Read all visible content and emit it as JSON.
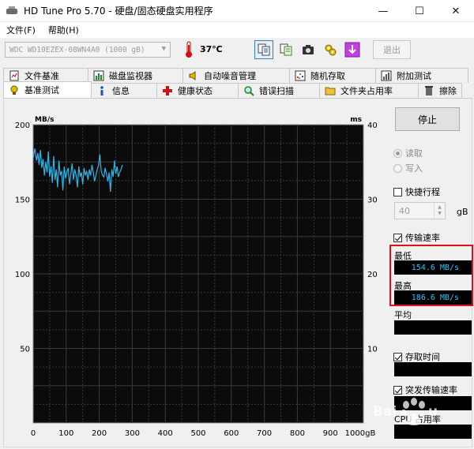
{
  "window": {
    "title": "HD Tune Pro 5.70 - 硬盘/固态硬盘实用程序"
  },
  "window_controls": {
    "minimize": "—",
    "maximize": "☐",
    "close": "✕"
  },
  "menu": [
    {
      "label": "文件(F)"
    },
    {
      "label": "帮助(H)"
    }
  ],
  "toolbar": {
    "drive": "WDC WD10EZEX-08WN4A0 (1000 gB)",
    "temperature": "37℃",
    "exit_label": "退出",
    "icons": [
      "copy-info-icon",
      "copy-table-icon",
      "camera-icon",
      "gear-icon",
      "save-icon"
    ]
  },
  "tabs_top": [
    {
      "label": "文件基准",
      "icon": "file-benchmark-icon"
    },
    {
      "label": "磁盘监视器",
      "icon": "disk-monitor-icon"
    },
    {
      "label": "自动噪音管理",
      "icon": "speaker-icon"
    },
    {
      "label": "随机存取",
      "icon": "random-access-icon"
    },
    {
      "label": "附加测试",
      "icon": "extra-tests-icon"
    }
  ],
  "tabs_bottom": [
    {
      "label": "基准测试",
      "icon": "benchmark-icon"
    },
    {
      "label": "信息",
      "icon": "info-icon"
    },
    {
      "label": "健康状态",
      "icon": "health-icon"
    },
    {
      "label": "错误扫描",
      "icon": "error-scan-icon"
    },
    {
      "label": "文件夹占用率",
      "icon": "folder-icon"
    },
    {
      "label": "擦除",
      "icon": "erase-icon"
    }
  ],
  "side": {
    "stop_label": "停止",
    "read_label": "读取",
    "write_label": "写入",
    "short_stroke_label": "快捷行程",
    "short_stroke_value": "40",
    "short_stroke_unit": "gB",
    "transfer_rate_label": "传输速率",
    "min_label": "最低",
    "min_value": "154.6 MB/s",
    "max_label": "最高",
    "max_value": "186.6 MB/s",
    "avg_label": "平均",
    "access_time_label": "存取时间",
    "burst_rate_label": "突发传输速率",
    "cpu_usage_label": "CPU 占用率"
  },
  "chart_data": {
    "type": "line",
    "ylabel": "MB/s",
    "y2label": "ms",
    "xlabel": "gB",
    "xlim": [
      0,
      1000
    ],
    "ylim": [
      0,
      200
    ],
    "y2lim": [
      0,
      40
    ],
    "xticks": [
      0,
      100,
      200,
      300,
      400,
      500,
      600,
      700,
      800,
      900,
      1000
    ],
    "yticks": [
      50,
      100,
      150,
      200
    ],
    "y2ticks": [
      10,
      20,
      30,
      40
    ],
    "grid": true,
    "series": [
      {
        "color": "#2fb5e8",
        "x": [
          0,
          5,
          10,
          14,
          18,
          22,
          26,
          30,
          34,
          38,
          42,
          46,
          50,
          54,
          58,
          62,
          66,
          70,
          74,
          78,
          82,
          86,
          90,
          94,
          98,
          102,
          106,
          110,
          114,
          118,
          122,
          126,
          130,
          134,
          138,
          142,
          146,
          150,
          154,
          158,
          162,
          166,
          170,
          174,
          178,
          182,
          186,
          190,
          194,
          198,
          202,
          206,
          210,
          214,
          218,
          222,
          226,
          230,
          234,
          238,
          242,
          246,
          250,
          254,
          258,
          262,
          266,
          270
        ],
        "values": [
          178,
          184,
          176,
          181,
          173,
          183,
          171,
          177,
          166,
          175,
          168,
          182,
          165,
          172,
          161,
          179,
          163,
          170,
          158,
          176,
          166,
          169,
          156,
          172,
          164,
          168,
          171,
          160,
          167,
          174,
          163,
          170,
          166,
          158,
          172,
          165,
          168,
          160,
          171,
          166,
          169,
          163,
          170,
          166,
          173,
          168,
          162,
          166,
          170,
          173,
          180,
          169,
          166,
          165,
          171,
          167,
          162,
          168,
          155,
          170,
          165,
          176,
          167,
          172,
          165,
          168,
          170,
          173
        ]
      }
    ]
  }
}
